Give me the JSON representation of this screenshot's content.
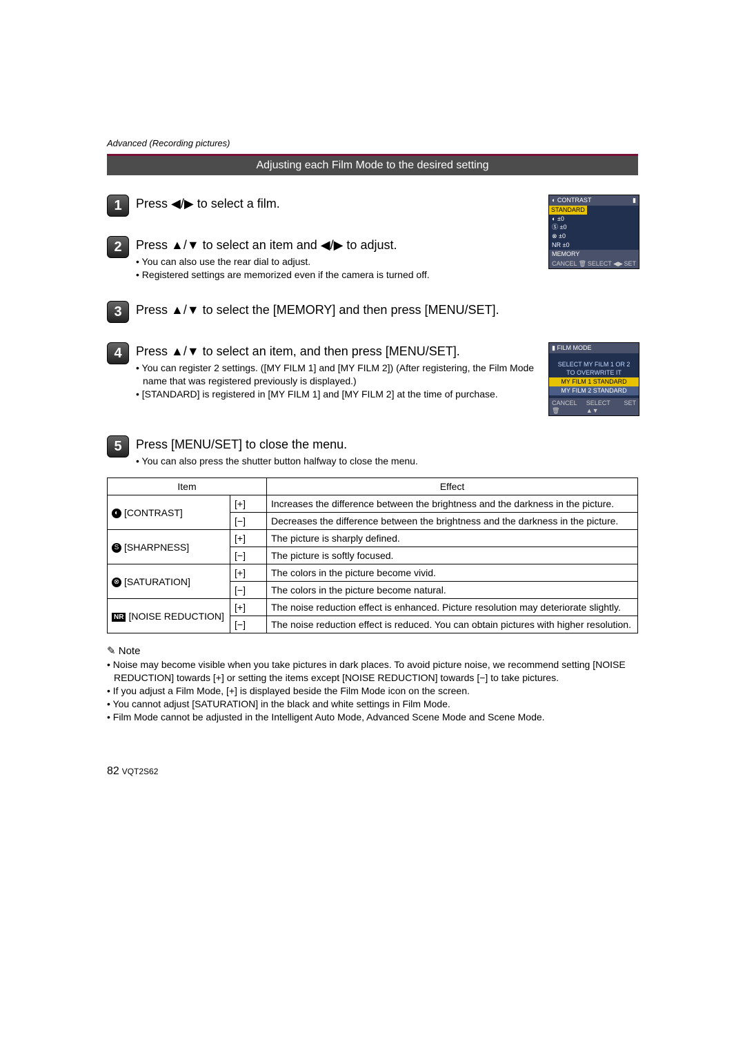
{
  "breadcrumb": "Advanced (Recording pictures)",
  "banner": "Adjusting each Film Mode to the desired setting",
  "lcd1": {
    "header_left": "◐ CONTRAST",
    "header_right": "▮",
    "standard": "STANDARD",
    "r1": "◐ ±0",
    "r2": "Ⓢ ±0",
    "r3": "⊗ ±0",
    "r4": "NR ±0",
    "memory": "MEMORY",
    "footer_l": "CANCEL 🗑",
    "footer_m": "SELECT ◀▶",
    "footer_r": "SET"
  },
  "lcd2": {
    "header": "▮ FILM MODE",
    "msg1": "SELECT MY FILM 1 OR 2",
    "msg2": "TO OVERWRITE IT",
    "sel": "MY FILM 1  STANDARD",
    "my2": "MY FILM 2  STANDARD",
    "footer_l": "CANCEL 🗑",
    "footer_m": "SELECT ▲▼",
    "footer_r": "SET"
  },
  "steps": [
    {
      "num": "1",
      "title": "Press ◀/▶ to select a film.",
      "bullets": []
    },
    {
      "num": "2",
      "title": "Press ▲/▼ to select an item and ◀/▶ to adjust.",
      "bullets": [
        "You can also use the rear dial to adjust.",
        "Registered settings are memorized even if the camera is turned off."
      ]
    },
    {
      "num": "3",
      "title": "Press ▲/▼ to select the [MEMORY] and then press [MENU/SET].",
      "bullets": []
    },
    {
      "num": "4",
      "title": "Press ▲/▼ to select an item, and then press [MENU/SET].",
      "bullets": [
        "You can register 2 settings. ([MY FILM 1] and [MY FILM 2]) (After registering, the Film Mode name that was registered previously is displayed.)",
        "[STANDARD] is registered in [MY FILM 1] and [MY FILM 2] at the time of purchase."
      ]
    },
    {
      "num": "5",
      "title": "Press [MENU/SET] to close the menu.",
      "bullets": [
        "You can also press the shutter button halfway to close the menu."
      ]
    }
  ],
  "table": {
    "headers": [
      "Item",
      "Effect"
    ],
    "rows": [
      {
        "item": "[CONTRAST]",
        "icon": "◐",
        "plus": "Increases the difference between the brightness and the darkness in the picture.",
        "minus": "Decreases the difference between the brightness and the darkness in the picture."
      },
      {
        "item": "[SHARPNESS]",
        "icon": "S",
        "plus": "The picture is sharply defined.",
        "minus": "The picture is softly focused."
      },
      {
        "item": "[SATURATION]",
        "icon": "⊗",
        "plus": "The colors in the picture become vivid.",
        "minus": "The colors in the picture become natural."
      },
      {
        "item": "[NOISE REDUCTION]",
        "icon": "NR",
        "plus": "The noise reduction effect is enhanced. Picture resolution may deteriorate slightly.",
        "minus": "The noise reduction effect is reduced. You can obtain pictures with higher resolution."
      }
    ],
    "plus_sign": "[+]",
    "minus_sign": "[−]"
  },
  "note_heading": "Note",
  "notes": [
    "Noise may become visible when you take pictures in dark places. To avoid picture noise, we recommend setting [NOISE REDUCTION] towards [+] or setting the items except [NOISE REDUCTION] towards [−] to take pictures.",
    "If you adjust a Film Mode, [+] is displayed beside the Film Mode icon on the screen.",
    "You cannot adjust [SATURATION] in the black and white settings in Film Mode.",
    "Film Mode cannot be adjusted in the Intelligent Auto Mode, Advanced Scene Mode and Scene Mode."
  ],
  "page_number": "82",
  "doc_code": "VQT2S62"
}
